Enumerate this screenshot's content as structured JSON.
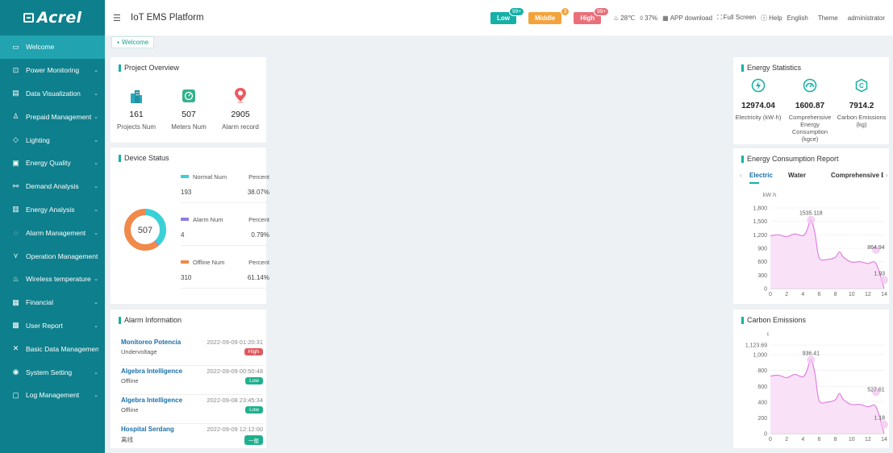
{
  "app": {
    "logo": "Acrel",
    "title": "IoT EMS Platform"
  },
  "header": {
    "levels": [
      {
        "label": "Low",
        "count": "99+"
      },
      {
        "label": "Middle",
        "count": "3"
      },
      {
        "label": "High",
        "count": "99+"
      }
    ],
    "temperature": "28℃",
    "humidity": "37%",
    "app_download": "APP download",
    "full_screen": "Full Screen",
    "help": "Help",
    "language": "English",
    "theme": "Theme",
    "user": "administrator"
  },
  "tabs": {
    "welcome": "Welcome"
  },
  "sidebar": {
    "items": [
      {
        "label": "Welcome",
        "icon": "monitor-icon",
        "glyph": "▭"
      },
      {
        "label": "Power Monitoring",
        "icon": "power-icon",
        "glyph": "⊡"
      },
      {
        "label": "Data Visualization",
        "icon": "chart-icon",
        "glyph": "▤"
      },
      {
        "label": "Prepaid Management",
        "icon": "users-icon",
        "glyph": "♙"
      },
      {
        "label": "Lighting",
        "icon": "light-icon",
        "glyph": "◇"
      },
      {
        "label": "Energy Quality",
        "icon": "quality-icon",
        "glyph": "▣"
      },
      {
        "label": "Demand Analysis",
        "icon": "demand-icon",
        "glyph": "⚯"
      },
      {
        "label": "Energy Analysis",
        "icon": "analysis-icon",
        "glyph": "▥"
      },
      {
        "label": "Alarm Management",
        "icon": "alarm-icon",
        "glyph": "◌"
      },
      {
        "label": "Operation Management",
        "icon": "operation-icon",
        "glyph": "⋎"
      },
      {
        "label": "Wireless temperature",
        "icon": "thermometer-icon",
        "glyph": "♨"
      },
      {
        "label": "Financial",
        "icon": "financial-icon",
        "glyph": "▦"
      },
      {
        "label": "User Report",
        "icon": "report-icon",
        "glyph": "▩"
      },
      {
        "label": "Basic Data Management",
        "icon": "data-icon",
        "glyph": "✕"
      },
      {
        "label": "System Setting",
        "icon": "settings-icon",
        "glyph": "◉"
      },
      {
        "label": "Log Management",
        "icon": "log-icon",
        "glyph": "▢"
      }
    ]
  },
  "overview": {
    "title": "Project Overview",
    "items": [
      {
        "value": "161",
        "label": "Projects Num"
      },
      {
        "value": "507",
        "label": "Meters Num"
      },
      {
        "value": "2905",
        "label": "Alarm record"
      }
    ]
  },
  "device_status": {
    "title": "Device Status",
    "total": "507",
    "percent_label": "Percent",
    "rows": [
      {
        "label": "Normal Num",
        "value": "193",
        "percent": "38.07%",
        "color": "#3ad0d8"
      },
      {
        "label": "Alarm Num",
        "value": "4",
        "percent": "0.79%",
        "color": "#8c7ee3"
      },
      {
        "label": "Offline Num",
        "value": "310",
        "percent": "61.14%",
        "color": "#f0894a"
      }
    ]
  },
  "alarm_info": {
    "title": "Alarm Information",
    "items": [
      {
        "name": "Monitoreo Potencia",
        "time": "2022-09-09 01:20:31",
        "status": "Undervoltage",
        "badge": "High",
        "color": "#e0585f"
      },
      {
        "name": "Algebra Intelligence",
        "time": "2022-09-09 00:50:48",
        "status": "Offline",
        "badge": "Low",
        "color": "#1fb08d"
      },
      {
        "name": "Algebra Intelligence",
        "time": "2022-09-08 23:45:34",
        "status": "Offline",
        "badge": "Low",
        "color": "#1fb08d"
      },
      {
        "name": "Hospital Serdang",
        "time": "2022-09-09 12:12:00",
        "status": "离线",
        "badge": "一般",
        "color": "#1fb08d"
      }
    ]
  },
  "energy_stats": {
    "title": "Energy Statistics",
    "items": [
      {
        "value": "12974.04",
        "label": "Electricity (kW·h)"
      },
      {
        "value": "1600.87",
        "label": "Comprehensive Energy Consumption (kgce)"
      },
      {
        "value": "7914.2",
        "label": "Carbon Emissions (kg)"
      }
    ]
  },
  "energy_report": {
    "title": "Energy Consumption Report",
    "tabs": [
      "Electric",
      "Water",
      "Comprehensive Ene"
    ],
    "prev": "‹",
    "next": "›"
  },
  "carbon": {
    "title": "Carbon Emissions"
  },
  "chart_data": [
    {
      "type": "area",
      "ylabel": "kW·h",
      "ylim": [
        0,
        1800
      ],
      "yticks": [
        "0",
        "300",
        "600",
        "900",
        "1,200",
        "1,500",
        "1,800"
      ],
      "xticks": [
        "0",
        "2",
        "4",
        "6",
        "8",
        "10",
        "12",
        "14"
      ],
      "x": [
        0,
        1,
        2,
        3,
        4,
        4.5,
        5,
        5.5,
        6,
        7,
        8,
        8.5,
        9,
        10,
        11,
        12,
        13,
        14
      ],
      "y": [
        1180,
        1200,
        1160,
        1220,
        1180,
        1300,
        1535.118,
        1220,
        690,
        650,
        700,
        820,
        700,
        590,
        600,
        560,
        560,
        0
      ],
      "annotations": [
        {
          "x": 5,
          "y": 1535.118,
          "text": "1535.118"
        },
        {
          "x": 13,
          "y": 864.94,
          "text": "864.94"
        },
        {
          "x": 14,
          "y": 193,
          "text": "1.93"
        }
      ],
      "color": "#e27fe0"
    },
    {
      "type": "area",
      "ylabel": "t",
      "ylim": [
        0,
        1123.69
      ],
      "yticks": [
        "0",
        "200",
        "400",
        "600",
        "800",
        "1,000",
        "1,123.69"
      ],
      "ytick_values": [
        0,
        200,
        400,
        600,
        800,
        1000,
        1123.69
      ],
      "xticks": [
        "0",
        "2",
        "4",
        "6",
        "8",
        "10",
        "12",
        "14"
      ],
      "x": [
        0,
        1,
        2,
        3,
        4,
        4.5,
        5,
        5.5,
        6,
        7,
        8,
        8.5,
        9,
        10,
        11,
        12,
        13,
        14
      ],
      "y": [
        730,
        740,
        710,
        750,
        720,
        800,
        936.41,
        750,
        420,
        400,
        430,
        510,
        430,
        370,
        370,
        340,
        340,
        0
      ],
      "annotations": [
        {
          "x": 5,
          "y": 936.41,
          "text": "936.41"
        },
        {
          "x": 13,
          "y": 527.61,
          "text": "527.61"
        },
        {
          "x": 14,
          "y": 118,
          "text": "1.18"
        }
      ],
      "color": "#e27fe0"
    }
  ]
}
